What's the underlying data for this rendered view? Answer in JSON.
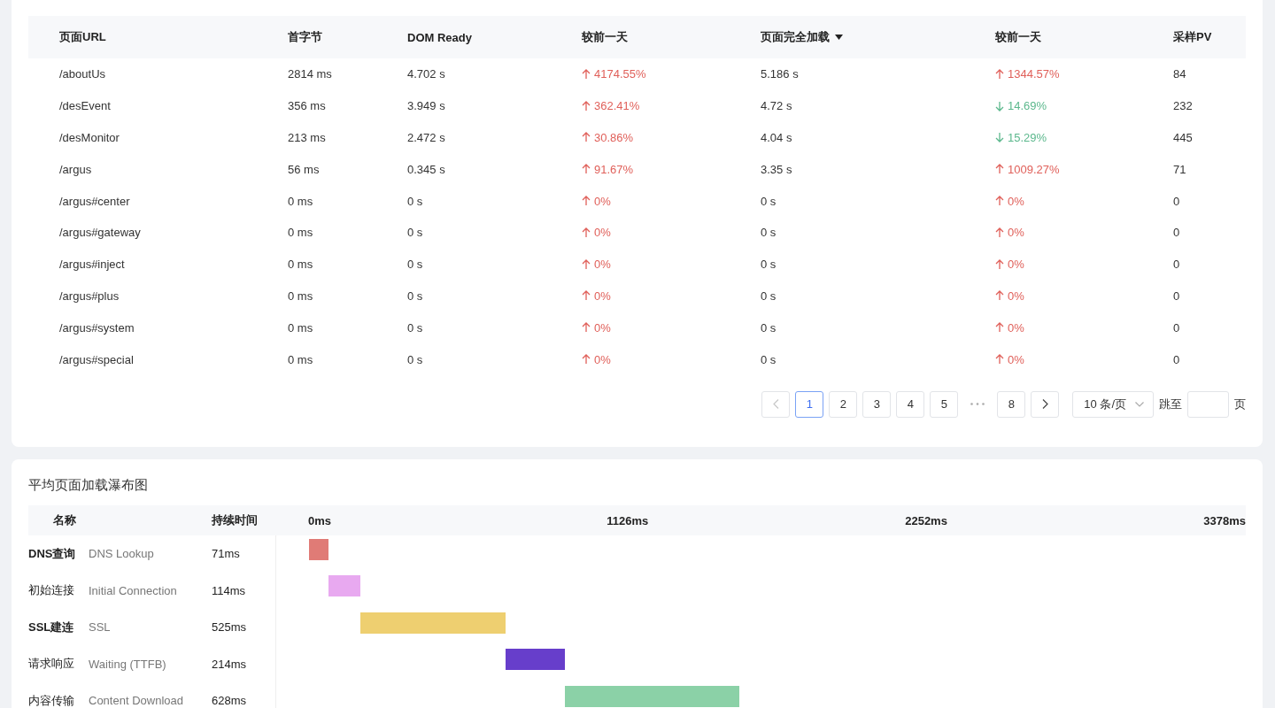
{
  "page_table": {
    "columns": [
      {
        "label": "页面URL"
      },
      {
        "label": "首字节"
      },
      {
        "label": "DOM Ready"
      },
      {
        "label": "较前一天"
      },
      {
        "label": "页面完全加载",
        "sorted": true
      },
      {
        "label": "较前一天"
      },
      {
        "label": "采样PV"
      }
    ],
    "rows": [
      {
        "url": "/aboutUs",
        "ttfb": "2814 ms",
        "dom_ready": "4.702 s",
        "dom_change": {
          "text": "4174.55%",
          "rising": true
        },
        "full_load": "5.186 s",
        "load_change": {
          "text": "1344.57%",
          "rising": true
        },
        "pv": "84"
      },
      {
        "url": "/desEvent",
        "ttfb": "356 ms",
        "dom_ready": "3.949 s",
        "dom_change": {
          "text": "362.41%",
          "rising": true
        },
        "full_load": "4.72 s",
        "load_change": {
          "text": "14.69%",
          "rising": false
        },
        "pv": "232"
      },
      {
        "url": "/desMonitor",
        "ttfb": "213 ms",
        "dom_ready": "2.472 s",
        "dom_change": {
          "text": "30.86%",
          "rising": true
        },
        "full_load": "4.04 s",
        "load_change": {
          "text": "15.29%",
          "rising": false
        },
        "pv": "445"
      },
      {
        "url": "/argus",
        "ttfb": "56 ms",
        "dom_ready": "0.345 s",
        "dom_change": {
          "text": "91.67%",
          "rising": true
        },
        "full_load": "3.35 s",
        "load_change": {
          "text": "1009.27%",
          "rising": true
        },
        "pv": "71"
      },
      {
        "url": "/argus#center",
        "ttfb": "0 ms",
        "dom_ready": "0 s",
        "dom_change": {
          "text": "0%",
          "rising": true
        },
        "full_load": "0 s",
        "load_change": {
          "text": "0%",
          "rising": true
        },
        "pv": "0"
      },
      {
        "url": "/argus#gateway",
        "ttfb": "0 ms",
        "dom_ready": "0 s",
        "dom_change": {
          "text": "0%",
          "rising": true
        },
        "full_load": "0 s",
        "load_change": {
          "text": "0%",
          "rising": true
        },
        "pv": "0"
      },
      {
        "url": "/argus#inject",
        "ttfb": "0 ms",
        "dom_ready": "0 s",
        "dom_change": {
          "text": "0%",
          "rising": true
        },
        "full_load": "0 s",
        "load_change": {
          "text": "0%",
          "rising": true
        },
        "pv": "0"
      },
      {
        "url": "/argus#plus",
        "ttfb": "0 ms",
        "dom_ready": "0 s",
        "dom_change": {
          "text": "0%",
          "rising": true
        },
        "full_load": "0 s",
        "load_change": {
          "text": "0%",
          "rising": true
        },
        "pv": "0"
      },
      {
        "url": "/argus#system",
        "ttfb": "0 ms",
        "dom_ready": "0 s",
        "dom_change": {
          "text": "0%",
          "rising": true
        },
        "full_load": "0 s",
        "load_change": {
          "text": "0%",
          "rising": true
        },
        "pv": "0"
      },
      {
        "url": "/argus#special",
        "ttfb": "0 ms",
        "dom_ready": "0 s",
        "dom_change": {
          "text": "0%",
          "rising": true
        },
        "full_load": "0 s",
        "load_change": {
          "text": "0%",
          "rising": true
        },
        "pv": "0"
      }
    ],
    "pagination": {
      "prev": {
        "disabled": true
      },
      "pages": [
        {
          "kind": "page",
          "label": "1",
          "selected": true
        },
        {
          "kind": "page",
          "label": "2",
          "selected": false
        },
        {
          "kind": "page",
          "label": "3",
          "selected": false
        },
        {
          "kind": "page",
          "label": "4",
          "selected": false
        },
        {
          "kind": "page",
          "label": "5",
          "selected": false
        },
        {
          "kind": "ellipsis"
        },
        {
          "kind": "page",
          "label": "8",
          "selected": false
        }
      ],
      "next": {
        "disabled": false
      },
      "page_size": "10 条/页",
      "jump_label": "跳至",
      "jump_suffix": "页"
    }
  },
  "waterfall": {
    "title": "平均页面加载瀑布图",
    "columns": [
      {
        "label": "名称"
      },
      {
        "label": "持续时间"
      }
    ],
    "ticks": [
      "0ms",
      "1126ms",
      "2252ms",
      "3378ms"
    ],
    "phases": [
      {
        "name": "DNS查询",
        "name_en": "DNS Lookup",
        "duration": "71ms",
        "color": "#e07b76"
      },
      {
        "name": "初始连接",
        "name_en": "Initial Connection",
        "duration": "114ms",
        "color": "#e8a9f0"
      },
      {
        "name": "SSL建连",
        "name_en": "SSL",
        "duration": "525ms",
        "color": "#eecf70"
      },
      {
        "name": "请求响应",
        "name_en": "Waiting (TTFB)",
        "duration": "214ms",
        "color": "#673ecb"
      },
      {
        "name": "内容传输",
        "name_en": "Content Download",
        "duration": "628ms",
        "color": "#8bd1a7"
      }
    ]
  }
}
